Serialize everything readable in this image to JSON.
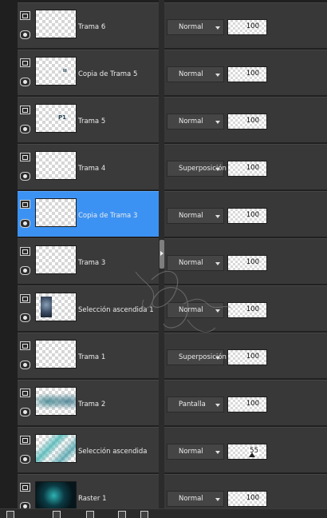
{
  "layers": [
    {
      "name": "Trama 6",
      "blend": "Normal",
      "opacity": "100",
      "thumb": "empty"
    },
    {
      "name": "Copia de Trama 5",
      "blend": "Normal",
      "opacity": "100",
      "thumb": "glyph-small"
    },
    {
      "name": "Trama 5",
      "blend": "Normal",
      "opacity": "100",
      "thumb": "glyph-text"
    },
    {
      "name": "Trama 4",
      "blend": "Superposición",
      "opacity": "100",
      "thumb": "empty"
    },
    {
      "name": "Copia de Trama 3",
      "blend": "Normal",
      "opacity": "100",
      "thumb": "empty",
      "selected": true
    },
    {
      "name": "Trama 3",
      "blend": "Normal",
      "opacity": "100",
      "thumb": "empty"
    },
    {
      "name": "Selección ascendida 1",
      "blend": "Normal",
      "opacity": "100",
      "thumb": "face"
    },
    {
      "name": "Trama 1",
      "blend": "Superposición",
      "opacity": "100",
      "thumb": "empty"
    },
    {
      "name": "Trama 2",
      "blend": "Pantalla",
      "opacity": "100",
      "thumb": "blur"
    },
    {
      "name": "Selección ascendida",
      "blend": "Normal",
      "opacity": "55",
      "thumb": "selection"
    },
    {
      "name": "Raster 1",
      "blend": "Normal",
      "opacity": "100",
      "thumb": "raster"
    }
  ],
  "thumb_glyphs": {
    "glyph_small": "ıı",
    "glyph_text": "P1"
  },
  "icons": {
    "visibility": "layer-visibility-icon",
    "lock": "layer-lock-icon"
  },
  "colors": {
    "panel_bg": "#3a3a3a",
    "selected_bg": "#3c92f3"
  },
  "toolbar": {
    "icons": [
      "new-layer-icon",
      "mask-icon",
      "adjust-icon",
      "group-icon",
      "delete-icon"
    ]
  }
}
